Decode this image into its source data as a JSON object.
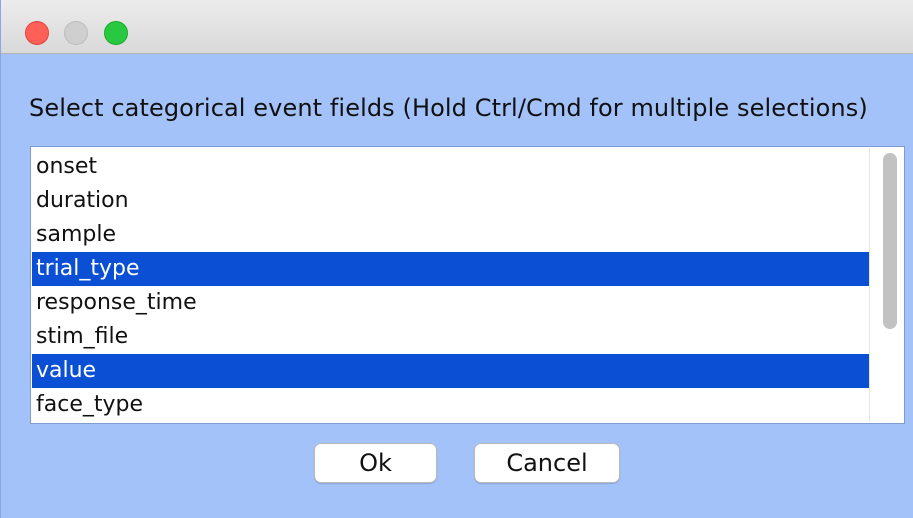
{
  "dialog": {
    "prompt": "Select categorical event fields (Hold Ctrl/Cmd for multiple selections)"
  },
  "list": {
    "items": [
      {
        "label": "onset",
        "selected": false
      },
      {
        "label": "duration",
        "selected": false
      },
      {
        "label": "sample",
        "selected": false
      },
      {
        "label": "trial_type",
        "selected": true
      },
      {
        "label": "response_time",
        "selected": false
      },
      {
        "label": "stim_file",
        "selected": false
      },
      {
        "label": "value",
        "selected": true
      },
      {
        "label": "face_type",
        "selected": false
      }
    ]
  },
  "buttons": {
    "ok_label": "Ok",
    "cancel_label": "Cancel"
  },
  "colors": {
    "window_background": "#a4c2fa",
    "selection": "#0b4fd4",
    "close": "#fe5f57",
    "zoom": "#28c840"
  },
  "icons": [
    "close-window-icon",
    "minimize-window-icon",
    "zoom-window-icon"
  ]
}
